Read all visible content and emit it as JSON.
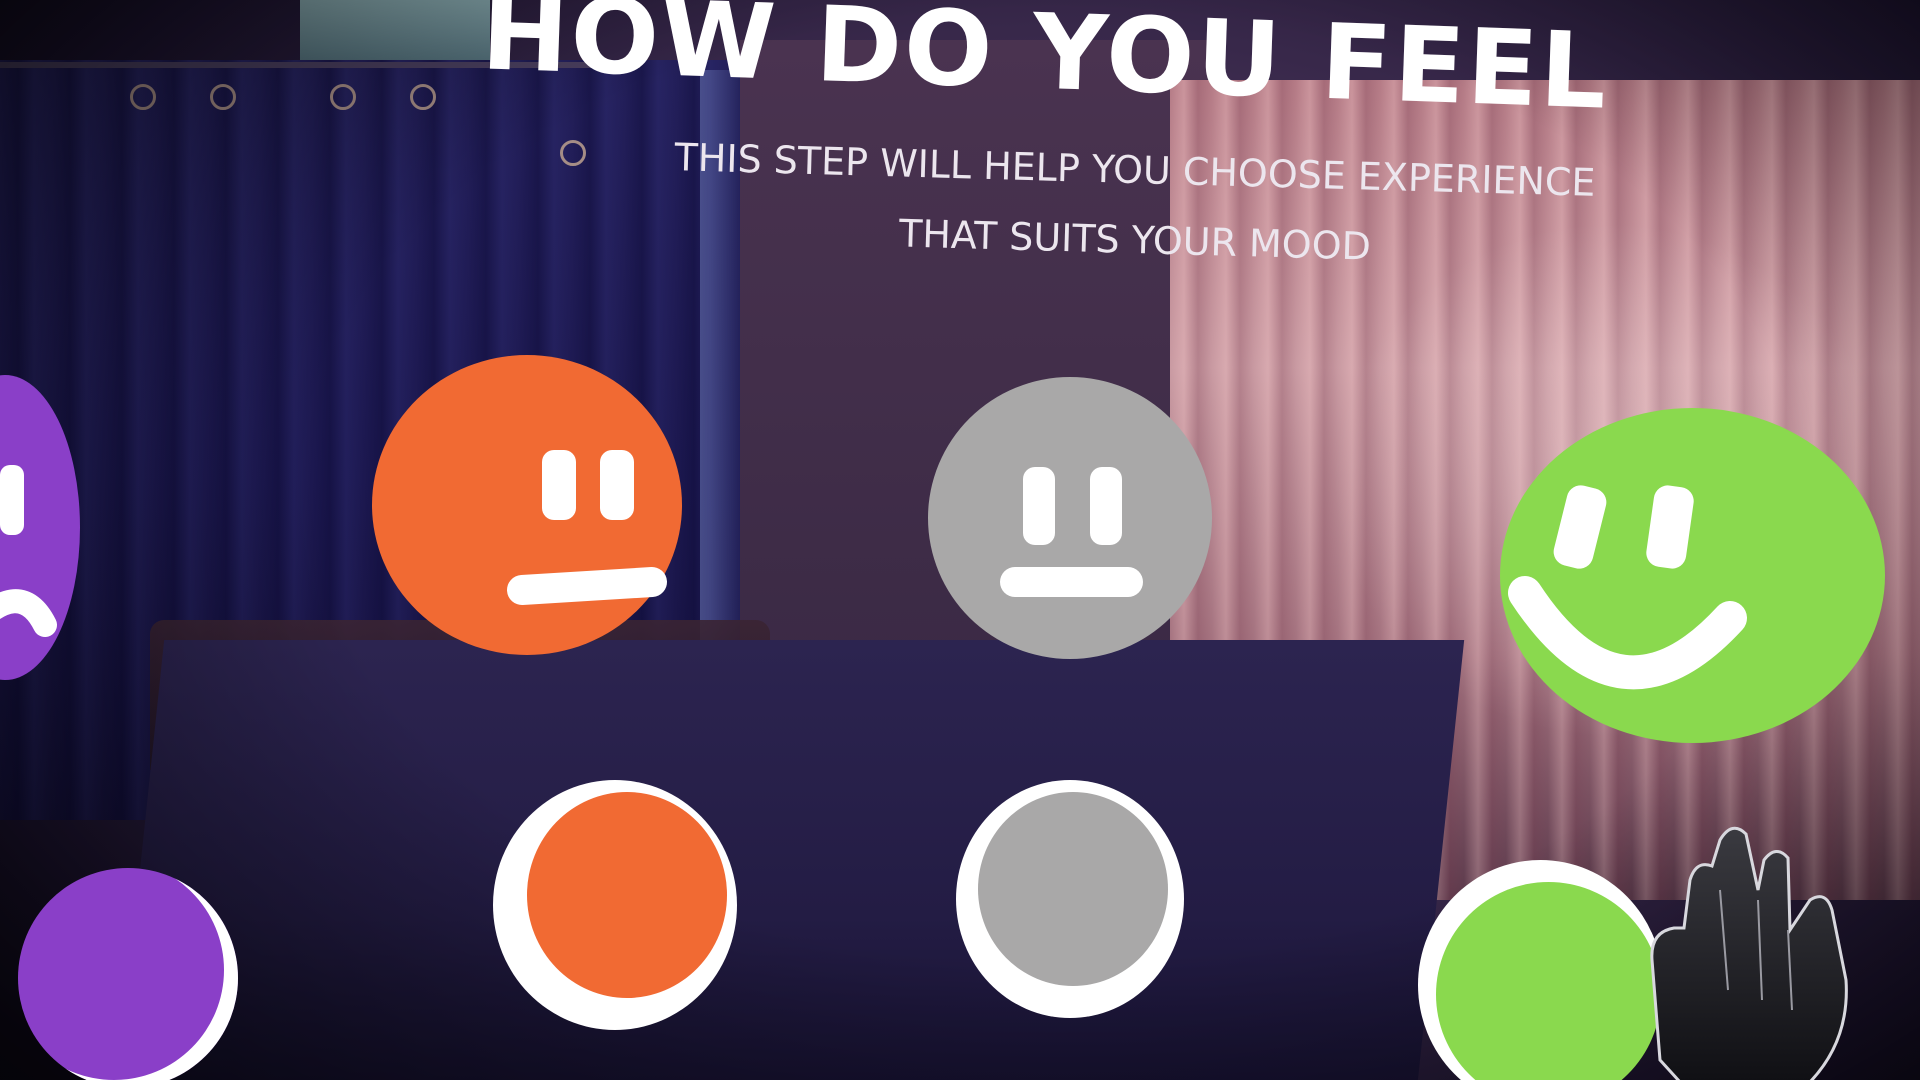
{
  "header": {
    "title": "HOW DO YOU FEEL",
    "subtitle_line1": "THIS STEP WILL HELP YOU CHOOSE EXPERIENCE",
    "subtitle_line2": "THAT SUITS YOUR MOOD"
  },
  "moods": [
    {
      "id": "sad",
      "face_icon": "sad-face-icon",
      "color": "#8a3fc8"
    },
    {
      "id": "unhappy",
      "face_icon": "frown-face-icon",
      "color": "#f16a33"
    },
    {
      "id": "neutral",
      "face_icon": "neutral-face-icon",
      "color": "#a9a8a8"
    },
    {
      "id": "happy",
      "face_icon": "smile-face-icon",
      "color": "#8ad94e"
    }
  ],
  "colors": {
    "sad": "#8a3fc8",
    "unhappy": "#f16a33",
    "neutral": "#a9a8a8",
    "happy": "#8ad94e",
    "text": "#ffffff"
  },
  "hand_icon": "vr-controller-hand-icon"
}
